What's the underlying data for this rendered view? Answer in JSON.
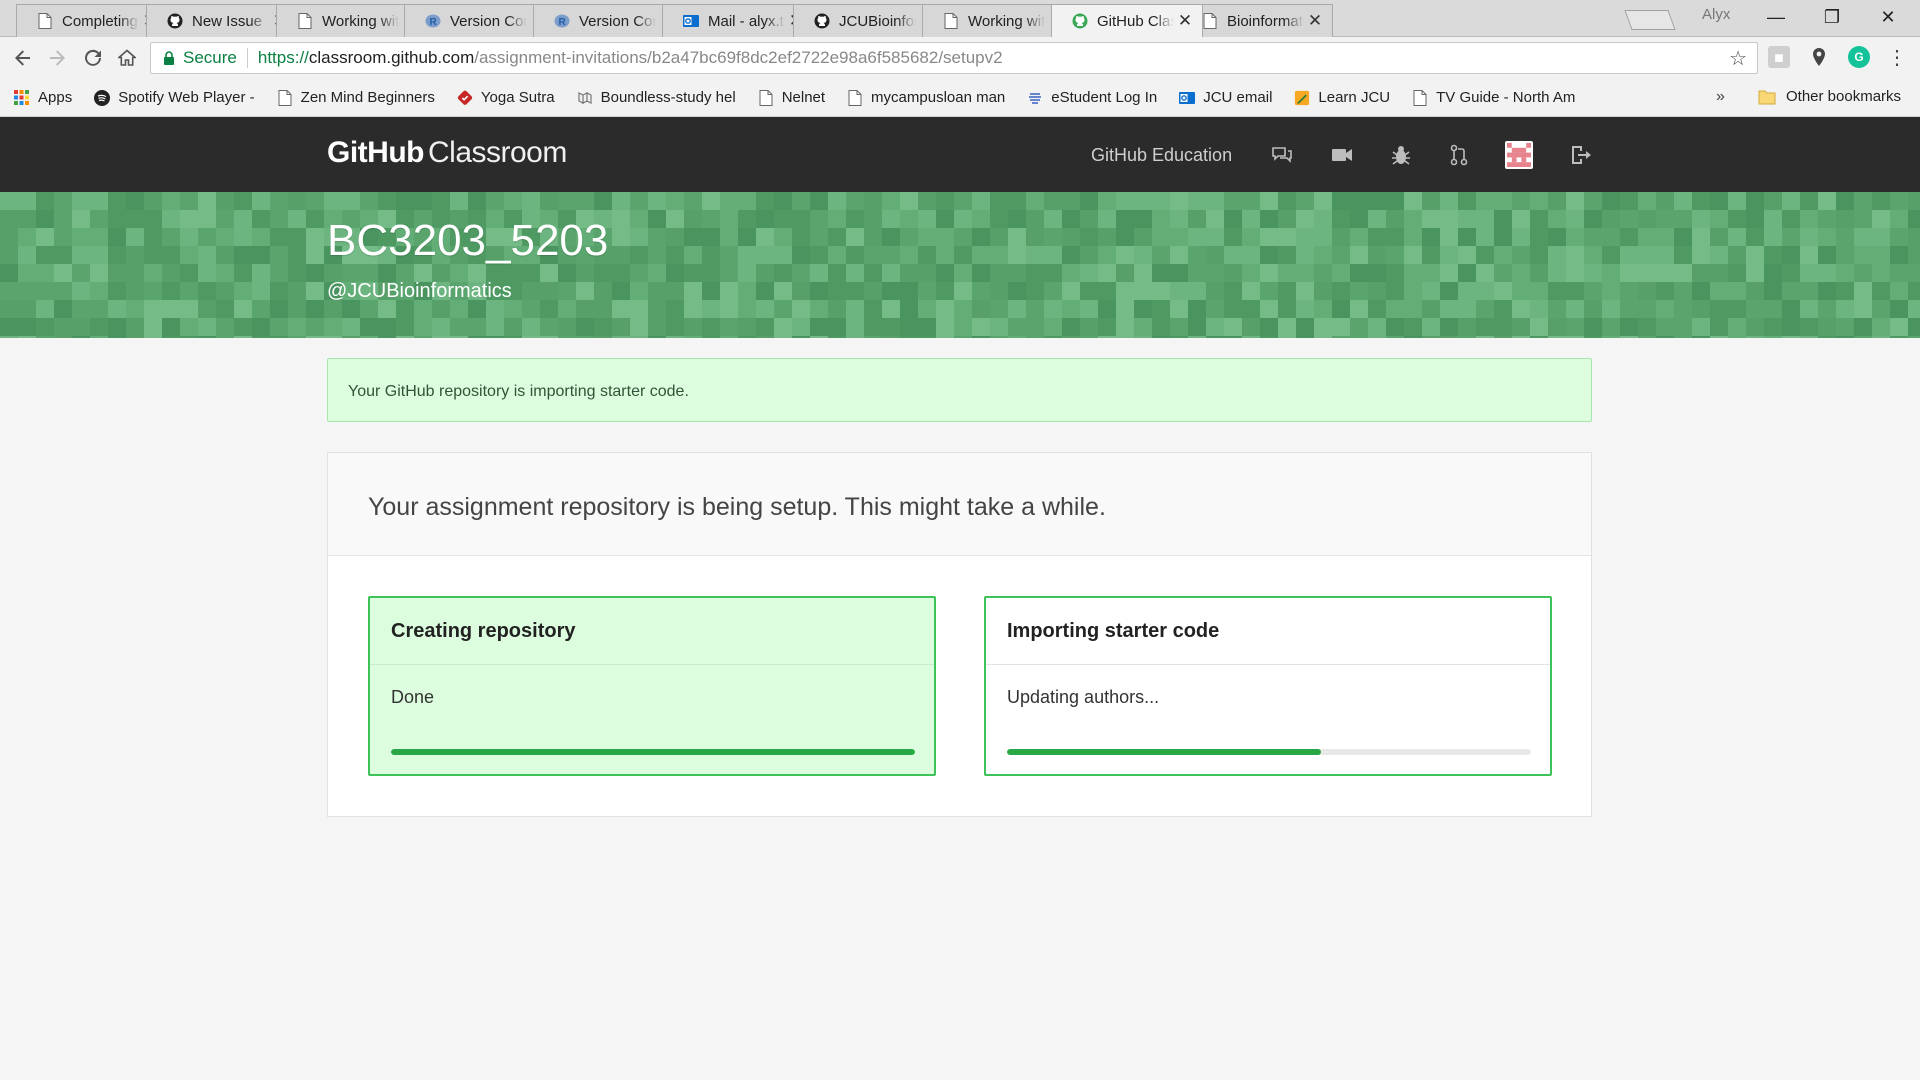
{
  "browser": {
    "tabs": [
      {
        "title": "Completing",
        "icon": "page-icon",
        "active": false
      },
      {
        "title": "New Issue · e",
        "icon": "github-icon",
        "active": false
      },
      {
        "title": "Working with",
        "icon": "page-icon",
        "active": false
      },
      {
        "title": "Version Contr",
        "icon": "r-icon",
        "active": false
      },
      {
        "title": "Version Contr",
        "icon": "r-icon",
        "active": false
      },
      {
        "title": "Mail - alyx.te",
        "icon": "outlook-icon",
        "active": false
      },
      {
        "title": "JCUBioinform",
        "icon": "github-icon",
        "active": false
      },
      {
        "title": "Working with",
        "icon": "page-icon",
        "active": false
      },
      {
        "title": "GitHub Class",
        "icon": "github-classroom-icon",
        "active": true
      },
      {
        "title": "Bioinformatic",
        "icon": "page-icon",
        "active": false
      }
    ],
    "close_glyph": "✕",
    "profile_name": "Alyx",
    "window_controls": {
      "minimize": "—",
      "maximize": "❐",
      "close": "✕"
    },
    "address": {
      "secure_label": "Secure",
      "scheme": "https://",
      "host": "classroom.github.com",
      "path": "/assignment-invitations/b2a47bc69f8dc2ef2722e98a6f585682/setupv2"
    },
    "bookmarks": [
      {
        "label": "Apps",
        "icon": "apps-grid-icon"
      },
      {
        "label": "Spotify Web Player -",
        "icon": "spotify-icon"
      },
      {
        "label": "Zen Mind Beginners",
        "icon": "page-icon"
      },
      {
        "label": "Yoga Sutra",
        "icon": "yoga-icon"
      },
      {
        "label": "Boundless-study hel",
        "icon": "boundless-icon"
      },
      {
        "label": "Nelnet",
        "icon": "page-icon"
      },
      {
        "label": "mycampusloan man",
        "icon": "page-icon"
      },
      {
        "label": "eStudent Log In",
        "icon": "estudent-icon"
      },
      {
        "label": "JCU email",
        "icon": "outlook-icon"
      },
      {
        "label": "Learn JCU",
        "icon": "learnjcu-icon"
      },
      {
        "label": "TV Guide - North Am",
        "icon": "page-icon"
      }
    ],
    "bookmarks_overflow": "»",
    "other_bookmarks": "Other bookmarks"
  },
  "header": {
    "logo_bold": "GitHub",
    "logo_light": "Classroom",
    "education_link": "GitHub Education",
    "icons": [
      "feedback-icon",
      "video-icon",
      "bug-icon",
      "pull-request-icon",
      "avatar",
      "sign-out-icon"
    ]
  },
  "hero": {
    "course_title": "BC3203_5203",
    "organization": "@JCUBioinformatics"
  },
  "flash": {
    "message": "Your GitHub repository is importing starter code."
  },
  "setup": {
    "heading": "Your assignment repository is being setup. This might take a while.",
    "steps": [
      {
        "title": "Creating repository",
        "status": "Done",
        "progress": 1.0
      },
      {
        "title": "Importing starter code",
        "status": "Updating authors...",
        "progress": 0.6
      }
    ]
  },
  "colors": {
    "header_bg": "#2b2b2b",
    "hero_green": "#5ea672",
    "success_bg": "#dcfdde",
    "progress_green": "#28a745",
    "step_border": "#3ec25a"
  }
}
